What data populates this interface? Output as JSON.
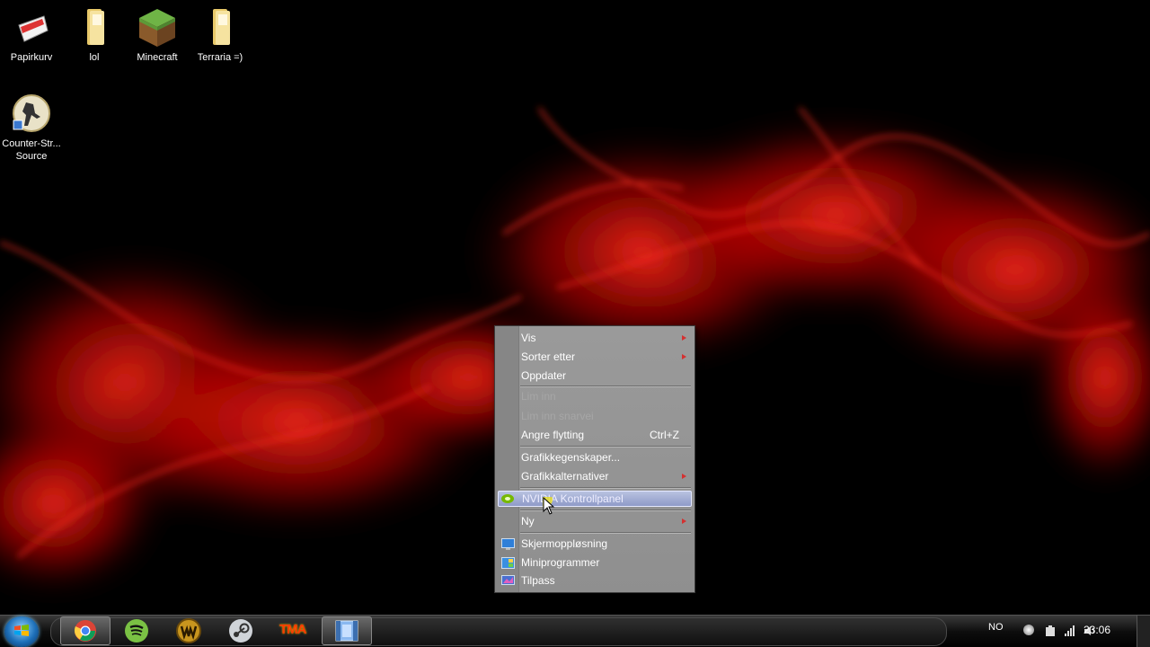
{
  "desktop": {
    "icons": [
      {
        "label": "Papirkurv",
        "icon": "recycle-bin-icon"
      },
      {
        "label": "lol",
        "icon": "folder-icon"
      },
      {
        "label": "Minecraft",
        "icon": "minecraft-icon"
      },
      {
        "label": "Terraria =)",
        "icon": "folder-icon"
      },
      {
        "label_line1": "Counter-Str...",
        "label_line2": "Source",
        "icon": "counter-strike-icon"
      }
    ]
  },
  "context_menu": {
    "items": [
      {
        "label": "Vis",
        "submenu": true
      },
      {
        "label": "Sorter etter",
        "submenu": true
      },
      {
        "label": "Oppdater"
      },
      {
        "label": "Lim inn",
        "disabled": true
      },
      {
        "label": "Lim inn snarvei",
        "disabled": true
      },
      {
        "label": "Angre flytting",
        "shortcut": "Ctrl+Z"
      },
      {
        "label": "Grafikkegenskaper..."
      },
      {
        "label": "Grafikkalternativer",
        "submenu": true
      },
      {
        "label": "NVIDIA Kontrollpanel",
        "highlighted": true,
        "icon": "nvidia-icon"
      },
      {
        "label": "Ny",
        "submenu": true
      },
      {
        "label": "Skjermoppløsning",
        "icon": "display-icon"
      },
      {
        "label": "Miniprogrammer",
        "icon": "gadgets-icon"
      },
      {
        "label": "Tilpass",
        "icon": "personalize-icon"
      }
    ]
  },
  "taskbar": {
    "apps": [
      "chrome-icon",
      "spotify-icon",
      "world-of-warcraft-icon",
      "steam-icon",
      "tma-icon",
      "video-window-icon"
    ],
    "tma_text": "TMA",
    "language": "NO",
    "clock": "23:06"
  },
  "colors": {
    "highlight": "#9aa4d4",
    "menu_bg": "#959595",
    "wallpaper_accent": "#e00000"
  }
}
